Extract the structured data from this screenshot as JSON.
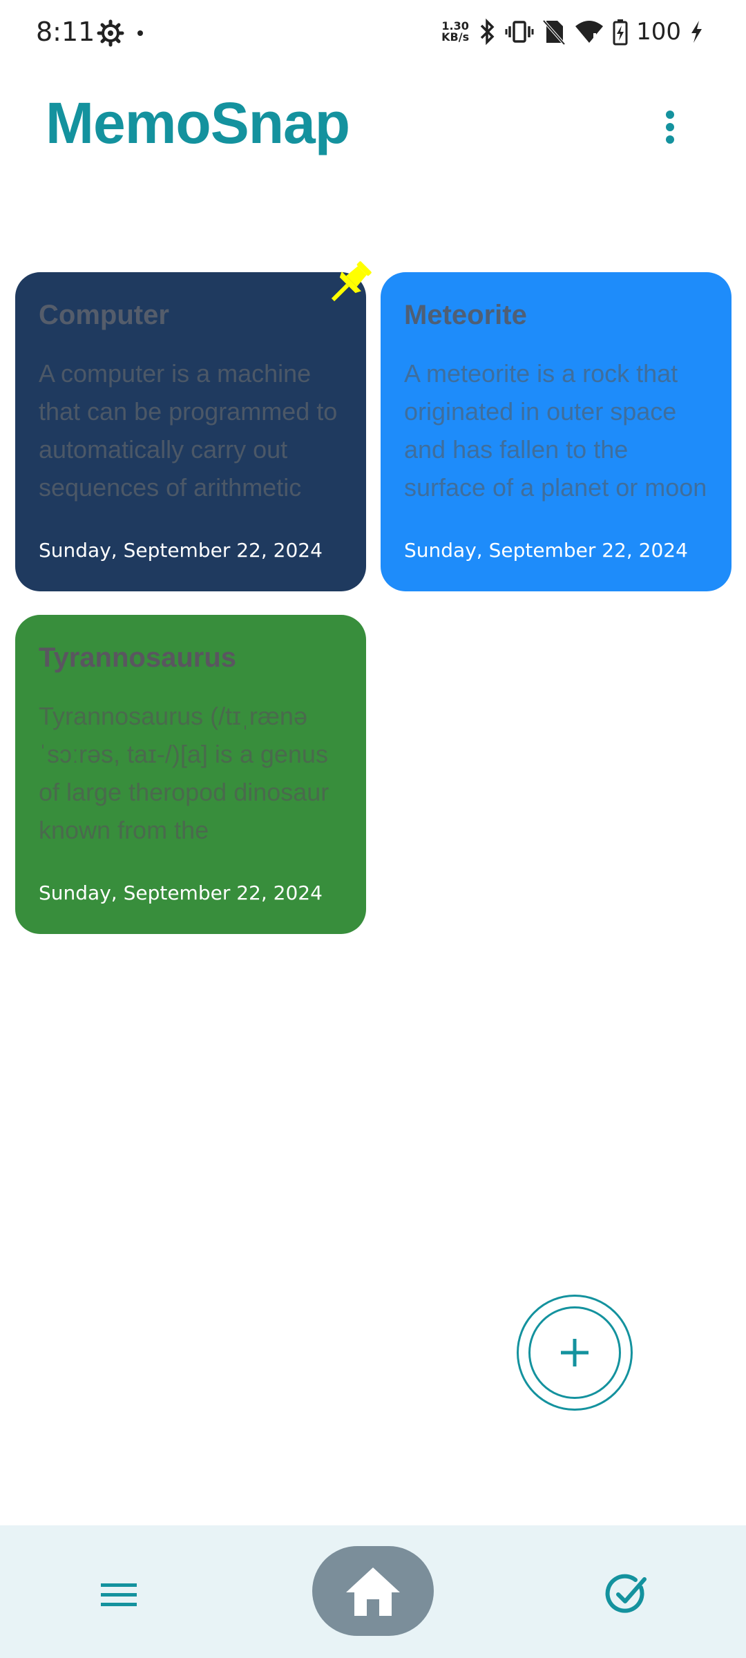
{
  "status_bar": {
    "time": "8:11",
    "net_speed_value": "1.30",
    "net_speed_unit": "KB/s",
    "battery": "100"
  },
  "header": {
    "title": "MemoSnap"
  },
  "notes": [
    {
      "title": "Computer",
      "body": "A computer is a machine that can be programmed to automatically carry out sequences of arithmetic",
      "date": "Sunday, September 22, 2024",
      "color": "#1f3a5f",
      "pinned": true
    },
    {
      "title": "Meteorite",
      "body": "A meteorite is a rock that originated in outer space and has fallen to the surface of a planet or moon",
      "date": "Sunday, September 22, 2024",
      "color": "#1e8cfa",
      "pinned": false
    },
    {
      "title": "Tyrannosaurus",
      "body": "Tyrannosaurus (/tɪˌrænə ˈsɔːrəs, taɪ-/)[a] is a genus of large theropod dinosaur known from the",
      "date": "Sunday, September 22, 2024",
      "color": "#388e3c",
      "pinned": false
    }
  ],
  "colors": {
    "accent": "#14929e",
    "pin": "#ffff00",
    "nav_background": "#e8f3f6",
    "nav_home_active": "#7b8e9a"
  },
  "icons": {
    "settings": "gear-icon",
    "pin": "pin-icon",
    "fab": "plus-icon",
    "nav_left": "hamburger-menu-icon",
    "nav_center": "home-icon",
    "nav_right": "check-circle-icon"
  }
}
